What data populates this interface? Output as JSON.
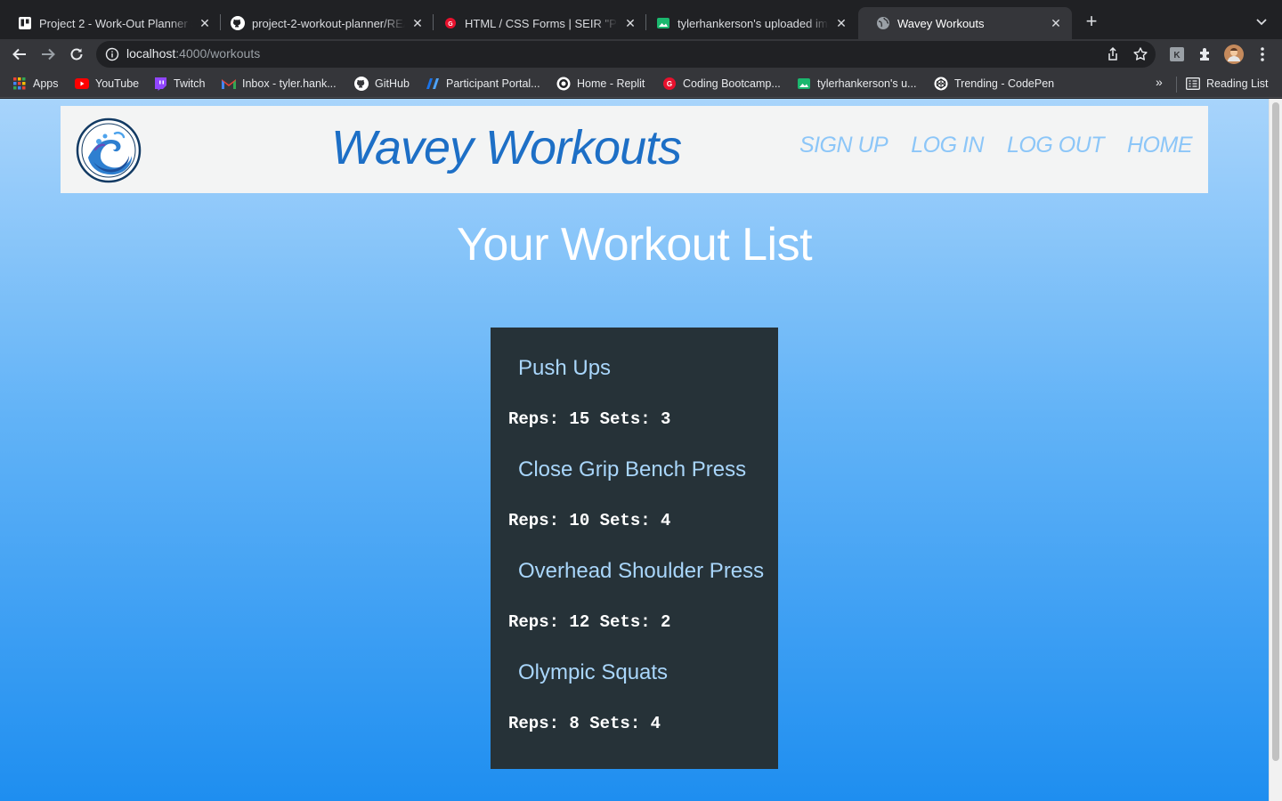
{
  "browser": {
    "tabs": [
      {
        "title": "Project 2 - Work-Out Planner S",
        "icon": "trello-icon"
      },
      {
        "title": "project-2-workout-planner/REA",
        "icon": "github-icon"
      },
      {
        "title": "HTML / CSS Forms | SEIR \"Pers",
        "icon": "ga-icon"
      },
      {
        "title": "tylerhankerson's uploaded ima",
        "icon": "imgur-icon"
      },
      {
        "title": "Wavey Workouts",
        "icon": "globe-icon"
      }
    ],
    "url_host": "localhost",
    "url_path": ":4000/workouts",
    "bookmarks": [
      {
        "label": "Apps",
        "icon": "apps-grid-icon"
      },
      {
        "label": "YouTube",
        "icon": "youtube-icon"
      },
      {
        "label": "Twitch",
        "icon": "twitch-icon"
      },
      {
        "label": "Inbox - tyler.hank...",
        "icon": "gmail-icon"
      },
      {
        "label": "GitHub",
        "icon": "github-icon"
      },
      {
        "label": "Participant Portal...",
        "icon": "portal-icon"
      },
      {
        "label": "Home - Replit",
        "icon": "replit-icon"
      },
      {
        "label": "Coding Bootcamp...",
        "icon": "ga-icon"
      },
      {
        "label": "tylerhankerson's u...",
        "icon": "imgur-icon"
      },
      {
        "label": "Trending - CodePen",
        "icon": "codepen-icon"
      }
    ],
    "more_bookmarks": "»",
    "reading_list": "Reading List"
  },
  "site": {
    "brand": "Wavey Workouts",
    "nav": [
      "SIGN UP",
      "LOG IN",
      "LOG OUT",
      "HOME"
    ]
  },
  "main": {
    "title": "Your Workout List",
    "workouts": [
      {
        "name": "Push Ups",
        "meta": "Reps: 15 Sets: 3"
      },
      {
        "name": "Close Grip Bench Press",
        "meta": "Reps: 10 Sets: 4"
      },
      {
        "name": "Overhead Shoulder Press",
        "meta": "Reps: 12 Sets: 2"
      },
      {
        "name": "Olympic Squats",
        "meta": "Reps: 8 Sets: 4"
      }
    ]
  },
  "colors": {
    "brand": "#1d6fc6",
    "nav_link": "#8cc6f8",
    "card_bg": "#263238",
    "workout_name": "#a9d6fb"
  }
}
